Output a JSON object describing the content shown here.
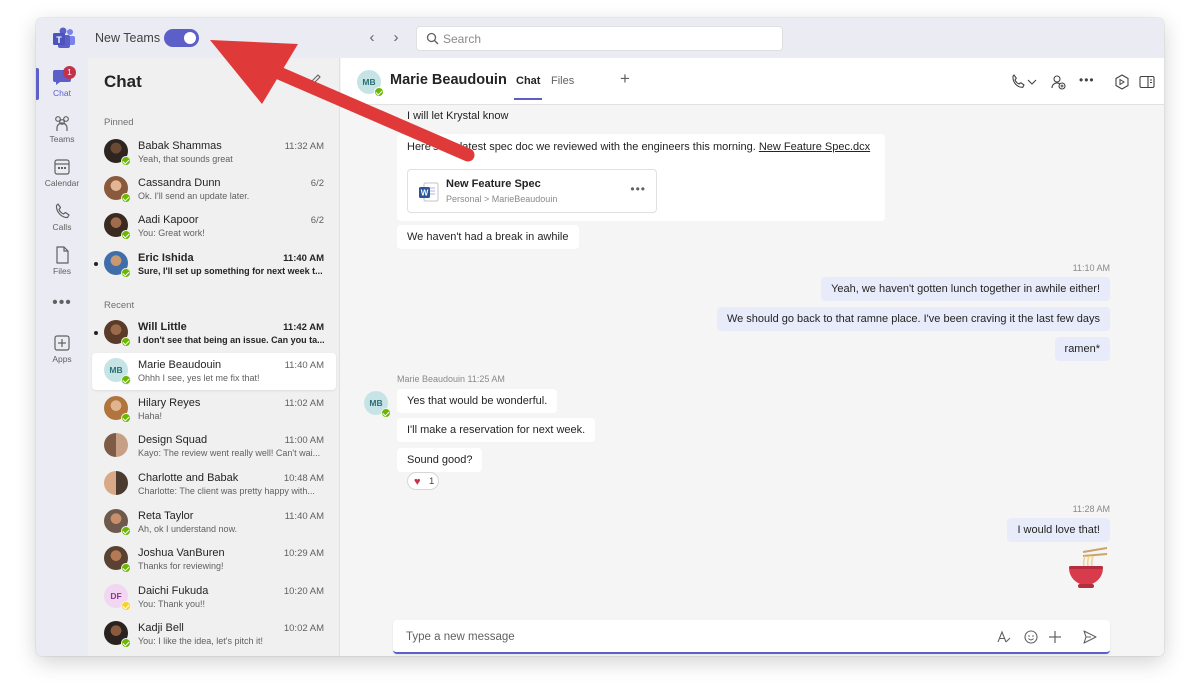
{
  "titlebar": {
    "new_teams_label": "New Teams",
    "new_teams_enabled": true,
    "search_placeholder": "Search"
  },
  "rail": {
    "items": [
      {
        "label": "Chat",
        "icon": "chat-icon",
        "badge": "1",
        "active": true
      },
      {
        "label": "Teams",
        "icon": "teams-icon"
      },
      {
        "label": "Calendar",
        "icon": "calendar-icon"
      },
      {
        "label": "Calls",
        "icon": "phone-icon"
      },
      {
        "label": "Files",
        "icon": "file-icon"
      },
      {
        "label": "Apps",
        "icon": "apps-icon"
      }
    ],
    "more": "•••"
  },
  "chatlist": {
    "title": "Chat",
    "pinned_label": "Pinned",
    "recent_label": "Recent",
    "pinned": [
      {
        "name": "Babak Shammas",
        "time": "11:32 AM",
        "preview": "Yeah, that sounds great",
        "unread": false,
        "presence": "available"
      },
      {
        "name": "Cassandra Dunn",
        "time": "6/2",
        "preview": "Ok. I'll send an update later.",
        "unread": false,
        "presence": "available"
      },
      {
        "name": "Aadi Kapoor",
        "time": "6/2",
        "preview": "You: Great work!",
        "unread": false,
        "presence": "available"
      },
      {
        "name": "Eric Ishida",
        "time": "11:40 AM",
        "preview": "Sure, I'll set up something for next week t...",
        "unread": true,
        "presence": "available"
      }
    ],
    "recent": [
      {
        "name": "Will Little",
        "time": "11:42 AM",
        "preview": "I don't see that being an issue. Can you ta...",
        "unread": true,
        "presence": "available"
      },
      {
        "name": "Marie Beaudouin",
        "time": "11:40 AM",
        "preview": "Ohhh I see, yes let me fix that!",
        "unread": false,
        "selected": true,
        "initials": "MB",
        "presence": "available"
      },
      {
        "name": "Hilary Reyes",
        "time": "11:02 AM",
        "preview": "Haha!",
        "unread": false,
        "presence": "available"
      },
      {
        "name": "Design Squad",
        "time": "11:00 AM",
        "preview": "Kayo: The review went really well! Can't wai...",
        "unread": false,
        "presence": "none"
      },
      {
        "name": "Charlotte and Babak",
        "time": "10:48 AM",
        "preview": "Charlotte: The client was pretty happy with...",
        "unread": false,
        "presence": "none"
      },
      {
        "name": "Reta Taylor",
        "time": "11:40 AM",
        "preview": "Ah, ok I understand now.",
        "unread": false,
        "presence": "available"
      },
      {
        "name": "Joshua VanBuren",
        "time": "10:29 AM",
        "preview": "Thanks for reviewing!",
        "unread": false,
        "presence": "available"
      },
      {
        "name": "Daichi Fukuda",
        "time": "10:20 AM",
        "preview": "You: Thank you!!",
        "unread": false,
        "initials": "DF",
        "presence": "away"
      },
      {
        "name": "Kadji Bell",
        "time": "10:02 AM",
        "preview": "You: I like the idea, let's pitch it!",
        "unread": false,
        "presence": "available"
      }
    ]
  },
  "conversation": {
    "contact_name": "Marie Beaudouin",
    "contact_initials": "MB",
    "tabs": [
      {
        "label": "Chat",
        "active": true
      },
      {
        "label": "Files",
        "active": false
      }
    ],
    "add_tab": "+",
    "messages": {
      "m1": "I will let Krystal know",
      "m2_prefix": "Here's the latest spec doc we reviewed with the engineers this morning.",
      "m2_link": "New Feature Spec.dcx",
      "file_name": "New Feature Spec",
      "file_path": "Personal > MarieBeaudouin",
      "file_more": "•••",
      "m3": "We haven't had a break in awhile",
      "ts1": "11:10 AM",
      "m4": "Yeah, we haven't gotten lunch together in awhile either!",
      "m5": "We should go back to that ramne place. I've been craving it the last few days",
      "m6": "ramen*",
      "sender_meta": "Marie Beaudouin  11:25 AM",
      "m7": "Yes that would be wonderful.",
      "m8": "I'll make a reservation for next week.",
      "m9": "Sound good?",
      "reaction_count": "1",
      "reaction_icon": "heart-icon",
      "ts2": "11:28 AM",
      "m10": "I would love that!",
      "sticker": "ramen-bowl-icon"
    },
    "compose_placeholder": "Type a new message"
  },
  "colors": {
    "brand": "#5b5fc7",
    "my_bubble": "#e8ebfa",
    "presence_available": "#6bb700",
    "presence_away": "#f8d22a",
    "annotation_arrow": "#e0393a",
    "badge": "#c4314b"
  }
}
